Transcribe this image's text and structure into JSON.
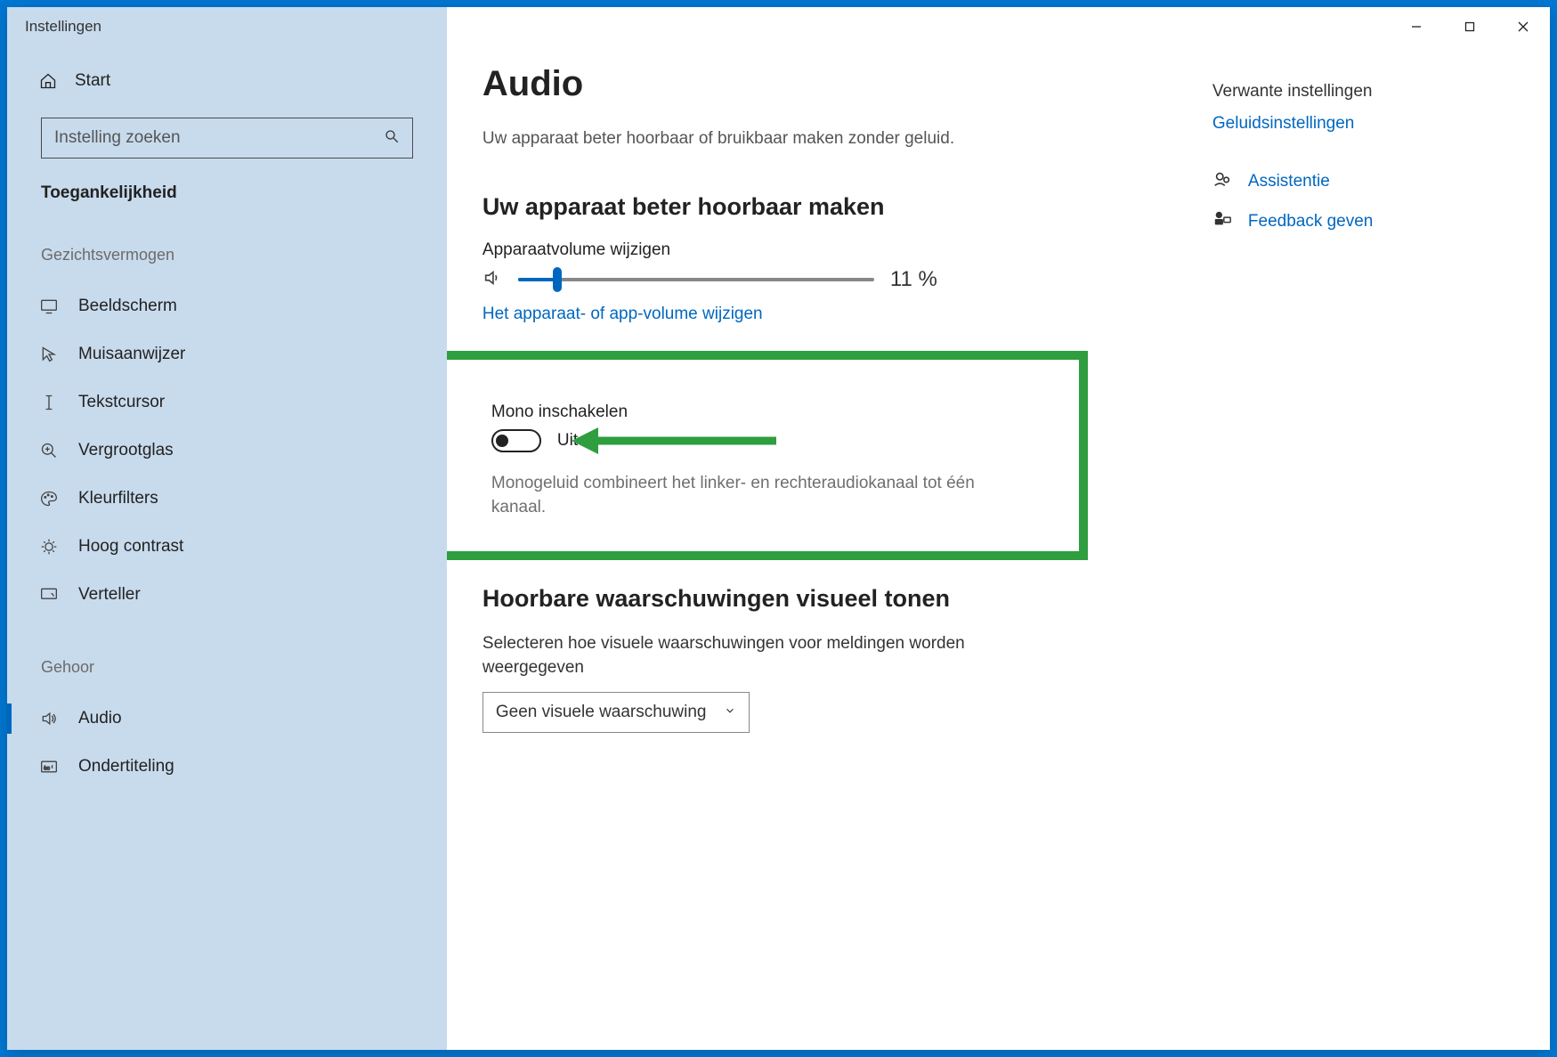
{
  "window_title": "Instellingen",
  "sidebar": {
    "home": "Start",
    "search_placeholder": "Instelling zoeken",
    "category": "Toegankelijkheid",
    "group_vision": "Gezichtsvermogen",
    "items_vision": [
      {
        "label": "Beeldscherm"
      },
      {
        "label": "Muisaanwijzer"
      },
      {
        "label": "Tekstcursor"
      },
      {
        "label": "Vergrootglas"
      },
      {
        "label": "Kleurfilters"
      },
      {
        "label": "Hoog contrast"
      },
      {
        "label": "Verteller"
      }
    ],
    "group_hearing": "Gehoor",
    "items_hearing": [
      {
        "label": "Audio"
      },
      {
        "label": "Ondertiteling"
      }
    ]
  },
  "main": {
    "title": "Audio",
    "subtitle": "Uw apparaat beter hoorbaar of bruikbaar maken zonder geluid.",
    "section1": "Uw apparaat beter hoorbaar maken",
    "volume_label": "Apparaatvolume wijzigen",
    "volume_percent": 11,
    "volume_display": "11 %",
    "volume_link": "Het apparaat- of app-volume wijzigen",
    "mono_label": "Mono inschakelen",
    "mono_state": "Uit",
    "mono_desc": "Monogeluid combineert het linker- en rechteraudiokanaal tot één kanaal.",
    "section2": "Hoorbare waarschuwingen visueel tonen",
    "visual_desc": "Selecteren hoe visuele waarschuwingen voor meldingen worden weergegeven",
    "dropdown_value": "Geen visuele waarschuwing"
  },
  "rail": {
    "related_heading": "Verwante instellingen",
    "sound_link": "Geluidsinstellingen",
    "assist": "Assistentie",
    "feedback": "Feedback geven"
  }
}
